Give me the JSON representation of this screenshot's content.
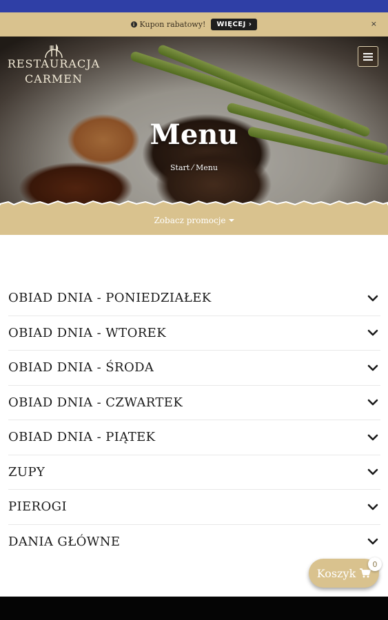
{
  "coupon_bar": {
    "text": "Kupon rabatowy!",
    "button_label": "WIĘCEJ ›",
    "close_label": "×"
  },
  "logo": {
    "line1": "RESTAURACJA",
    "line2": "CARMEN"
  },
  "hero": {
    "title": "Menu",
    "breadcrumb": "Start  ⁄  Menu"
  },
  "promo_bar": {
    "label": "Zobacz promocje"
  },
  "menu": {
    "items": [
      {
        "label": "OBIAD DNIA - PONIEDZIAŁEK"
      },
      {
        "label": "OBIAD DNIA - WTOREK"
      },
      {
        "label": "OBIAD DNIA - ŚRODA"
      },
      {
        "label": "OBIAD DNIA - CZWARTEK"
      },
      {
        "label": "OBIAD DNIA - PIĄTEK"
      },
      {
        "label": "ZUPY"
      },
      {
        "label": "PIEROGI"
      },
      {
        "label": "DANIA GŁÓWNE"
      }
    ]
  },
  "cart": {
    "label": "Koszyk",
    "count": "0"
  },
  "colors": {
    "accent": "#d9c28e",
    "status_bar": "#2f3fa6"
  }
}
